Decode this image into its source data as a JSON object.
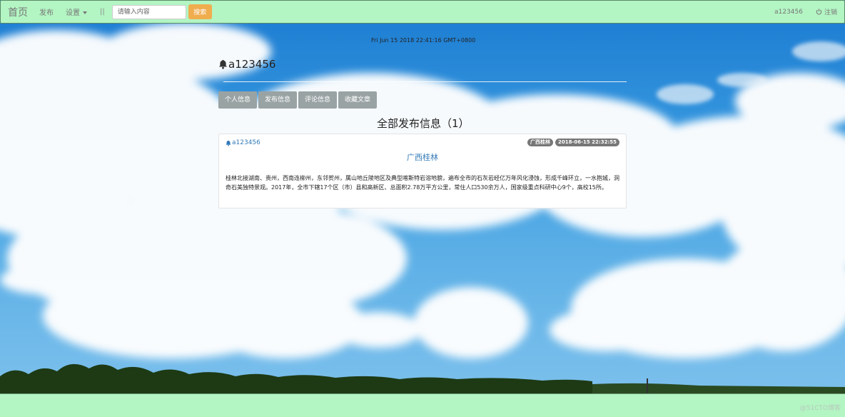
{
  "navbar": {
    "brand": "首页",
    "publish": "发布",
    "settings": "设置",
    "separator": "||",
    "search_placeholder": "请输入内容",
    "search_button": "搜索",
    "username": "a123456",
    "logout": "注销"
  },
  "page": {
    "timestamp": "Fri Jun 15 2018 22:41:16 GMT+0800",
    "profile_name": "a123456",
    "tabs": [
      "个人信息",
      "发布信息",
      "评论信息",
      "收藏文章"
    ],
    "section_title": "全部发布信息（1）"
  },
  "post": {
    "author": "a123456",
    "tag": "广西桂林",
    "date": "2018-06-15 22:32:55",
    "title": "广西桂林",
    "body": "桂林北接湖南、贵州，西南连柳州，东邻贺州，属山地丘陵地区及典型喀斯特岩溶地貌，遍布全市的石灰岩经亿万年风化浸蚀，形成千峰环立，一水抱城，洞奇石美独特景观。2017年，全市下辖17个区（市）县和高新区、总面积2.78万平方公里，常住人口530余万人，国家级重点科研中心9个，高校15所。"
  },
  "watermark": "@51CTO博客",
  "colors": {
    "navbar_bg": "#b3f5c3",
    "search_button": "#f0ad4e",
    "tab_bg": "#9aa3a3",
    "link": "#337ab7",
    "badge": "#777777"
  },
  "icons": [
    "bell-icon",
    "power-icon",
    "chevron-down-icon"
  ]
}
